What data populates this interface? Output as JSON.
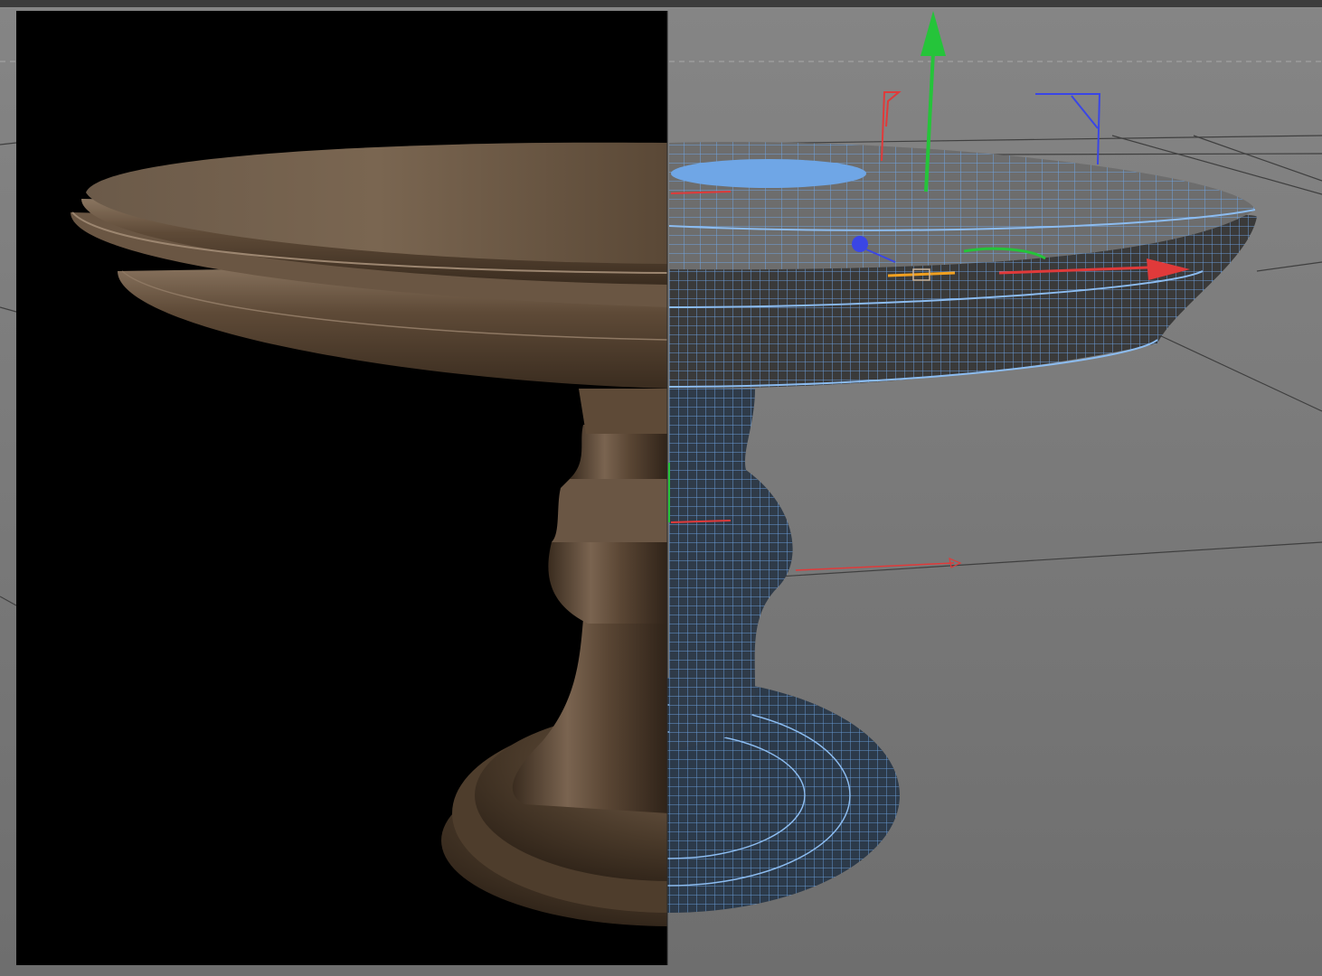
{
  "viewport": {
    "background_color": "#7e7e7e",
    "render_region_background": "#000000",
    "wireframe_color": "#6fa6e6",
    "wood_color": "#5a4836",
    "grid_color": "#3a3a3a",
    "safe_frame_color": "#a9a9a9"
  },
  "model": {
    "object": "round-pedestal-table"
  },
  "gizmo": {
    "x_axis_color": "#e03a3a",
    "y_axis_color": "#25c43a",
    "z_axis_color": "#3a46e6",
    "scale_handle_color": "#f0a020"
  }
}
